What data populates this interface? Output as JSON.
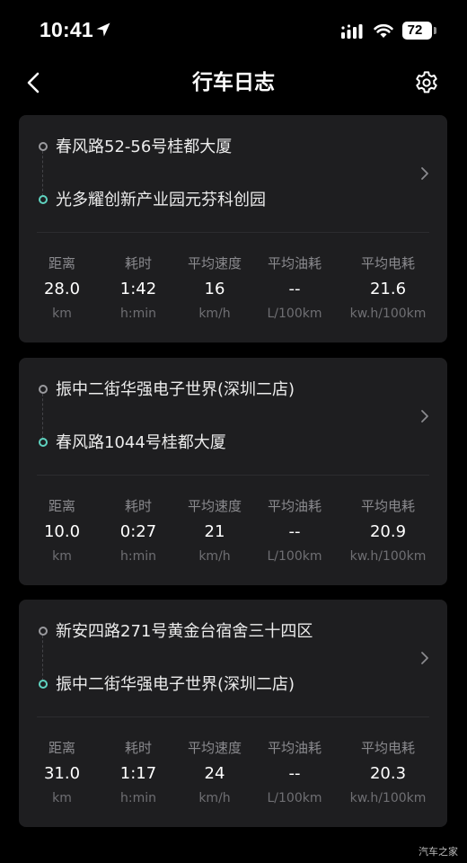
{
  "status_bar": {
    "time": "10:41",
    "battery": "72",
    "icons": [
      "location-arrow-icon",
      "cellular-signal-icon",
      "wifi-icon",
      "battery-icon"
    ]
  },
  "nav": {
    "title": "行车日志",
    "back_icon": "chevron-left-icon",
    "settings_icon": "gear-icon"
  },
  "stat_labels": [
    "距离",
    "耗时",
    "平均速度",
    "平均油耗",
    "平均电耗"
  ],
  "stat_units": [
    "km",
    "h:min",
    "km/h",
    "L/100km",
    "kw.h/100km"
  ],
  "trips": [
    {
      "start": "春风路52-56号桂都大厦",
      "end": "光多耀创新产业园元芬科创园",
      "stats": [
        "28.0",
        "1:42",
        "16",
        "--",
        "21.6"
      ]
    },
    {
      "start": "振中二街华强电子世界(深圳二店)",
      "end": "春风路1044号桂都大厦",
      "stats": [
        "10.0",
        "0:27",
        "21",
        "--",
        "20.9"
      ]
    },
    {
      "start": "新安四路271号黄金台宿舍三十四区",
      "end": "振中二街华强电子世界(深圳二店)",
      "stats": [
        "31.0",
        "1:17",
        "24",
        "--",
        "20.3"
      ]
    }
  ],
  "colors": {
    "background": "#000000",
    "card": "#1e1e20",
    "start_dot": "#9a9a9e",
    "end_dot": "#5fd3c0",
    "label": "#8a8a8e",
    "unit": "#6f6f73"
  },
  "watermark": "汽车之家"
}
